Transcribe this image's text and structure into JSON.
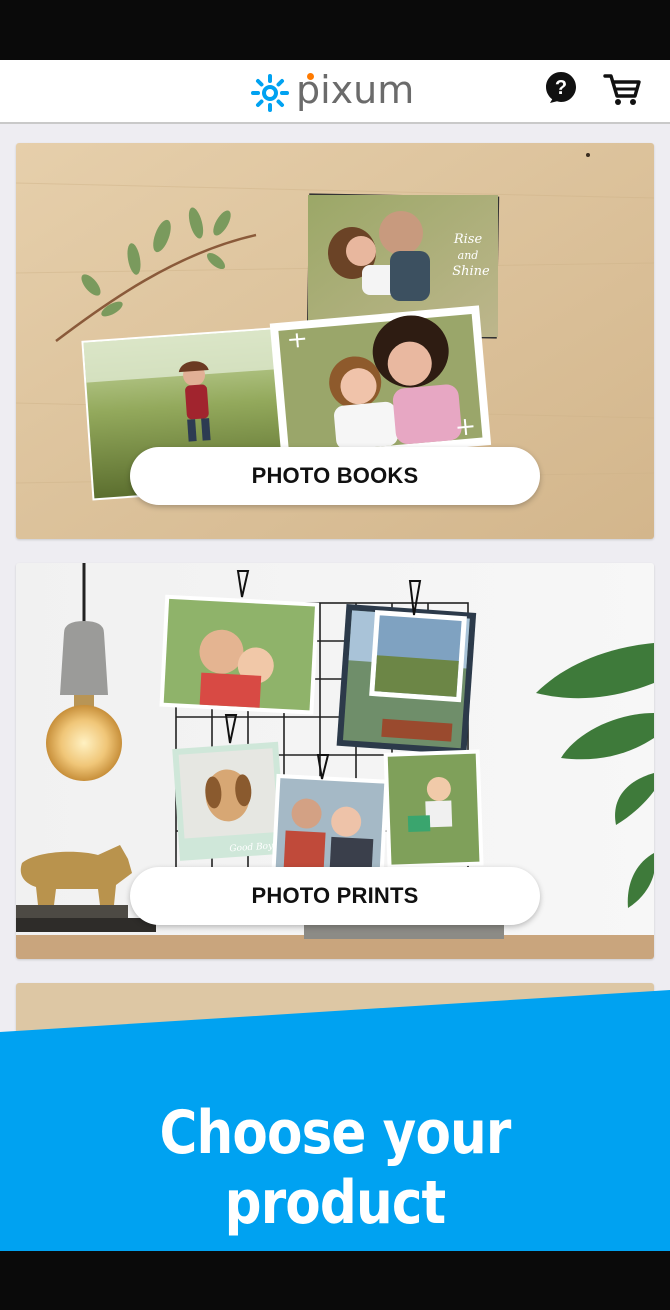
{
  "app": {
    "logo_text": "pixum",
    "colors": {
      "brand_blue": "#00a2f1",
      "brand_orange": "#ff7a00",
      "header_bg": "#ffffff",
      "page_bg": "#eeedf2"
    }
  },
  "header": {
    "help_icon": "help-circle-icon",
    "cart_icon": "shopping-cart-icon"
  },
  "products": [
    {
      "label": "PHOTO BOOKS",
      "image": "photo-books-scene"
    },
    {
      "label": "PHOTO PRINTS",
      "image": "photo-prints-scene"
    }
  ],
  "banner": {
    "text": "Choose your product"
  }
}
